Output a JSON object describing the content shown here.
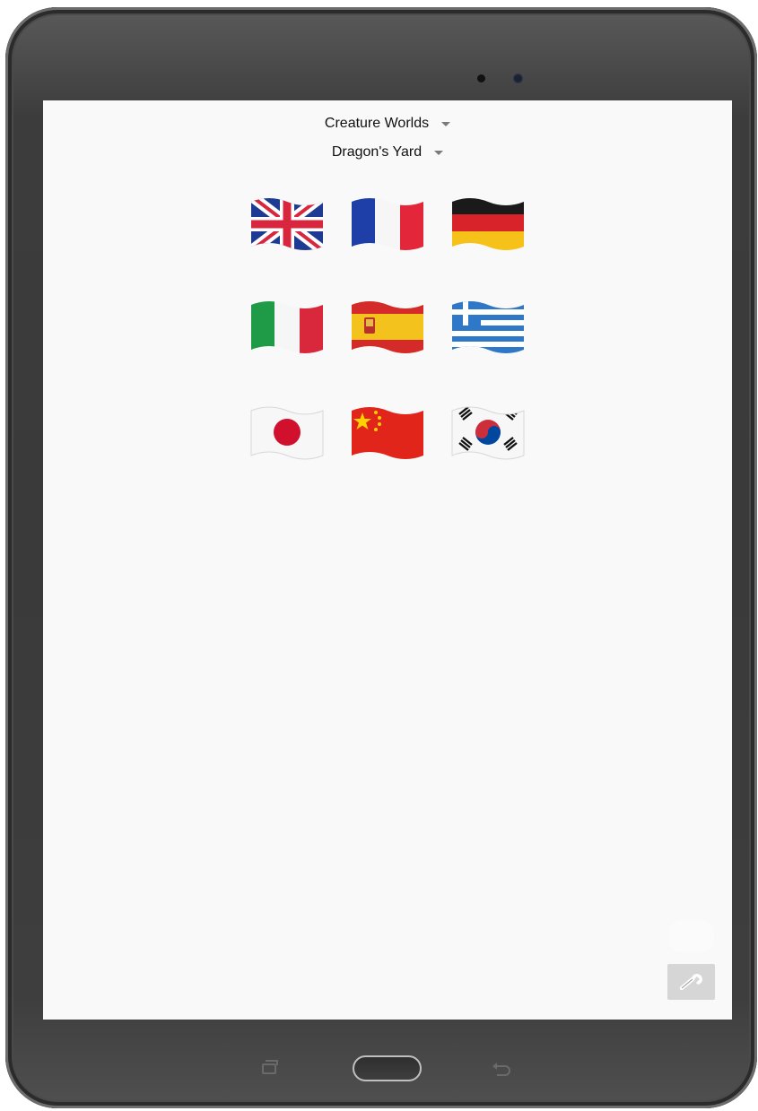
{
  "selectors": {
    "world": {
      "label": "Creature Worlds"
    },
    "location": {
      "label": "Dragon's Yard"
    }
  },
  "languages": [
    {
      "country": "United Kingdom",
      "icon": "uk-flag-icon"
    },
    {
      "country": "France",
      "icon": "france-flag-icon"
    },
    {
      "country": "Germany",
      "icon": "germany-flag-icon"
    },
    {
      "country": "Italy",
      "icon": "italy-flag-icon"
    },
    {
      "country": "Spain",
      "icon": "spain-flag-icon"
    },
    {
      "country": "Greece",
      "icon": "greece-flag-icon"
    },
    {
      "country": "Japan",
      "icon": "japan-flag-icon"
    },
    {
      "country": "China",
      "icon": "china-flag-icon"
    },
    {
      "country": "South Korea",
      "icon": "south-korea-flag-icon"
    }
  ],
  "tools": {
    "icon": "wrench-icon"
  },
  "navigation": {
    "recent": "recent-apps-icon",
    "home": "home-button",
    "back": "back-icon"
  },
  "colors": {
    "screen": "#f9f9f9",
    "frame": "#3c3c3c",
    "tool_button": "#d6d6d6"
  }
}
